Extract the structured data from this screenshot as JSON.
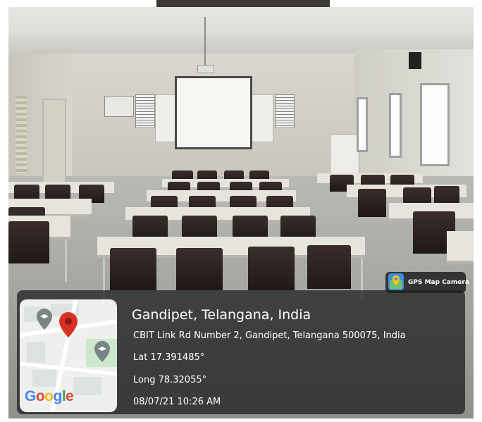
{
  "badge": {
    "label": "GPS Map Camera",
    "icon": "gps-map-camera-icon"
  },
  "map": {
    "provider_logo": "Google",
    "pin_color": "#d93025"
  },
  "location": {
    "title": "Gandipet, Telangana, India",
    "address": "CBIT Link Rd Number 2, Gandipet, Telangana 500075, India",
    "latitude": "Lat 17.391485°",
    "longitude": "Long 78.32055°",
    "timestamp": "08/07/21 10:26 AM"
  },
  "colors": {
    "overlay": "#19191c",
    "text": "#ffffff",
    "chairs": "#2a201e",
    "desks": "#e6e4dc"
  }
}
